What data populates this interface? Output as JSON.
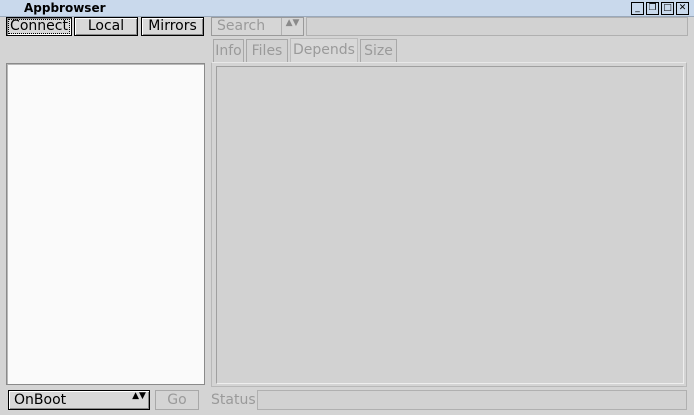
{
  "window": {
    "title": "Appbrowser",
    "controls": {
      "minimize": "_",
      "restore": "❐",
      "maximize": "□",
      "close": "✕"
    }
  },
  "toolbar": {
    "connect_label": "Connect",
    "local_label": "Local",
    "mirrors_label": "Mirrors",
    "search_placeholder": "Search",
    "search_entry_value": ""
  },
  "tabs": [
    {
      "label": "Info"
    },
    {
      "label": "Files"
    },
    {
      "label": "Depends"
    },
    {
      "label": "Size"
    }
  ],
  "bottom": {
    "onboot_value": "OnBoot",
    "go_label": "Go",
    "status_label": "Status",
    "status_value": ""
  },
  "icons": {
    "combo_arrows": "▲▼"
  }
}
